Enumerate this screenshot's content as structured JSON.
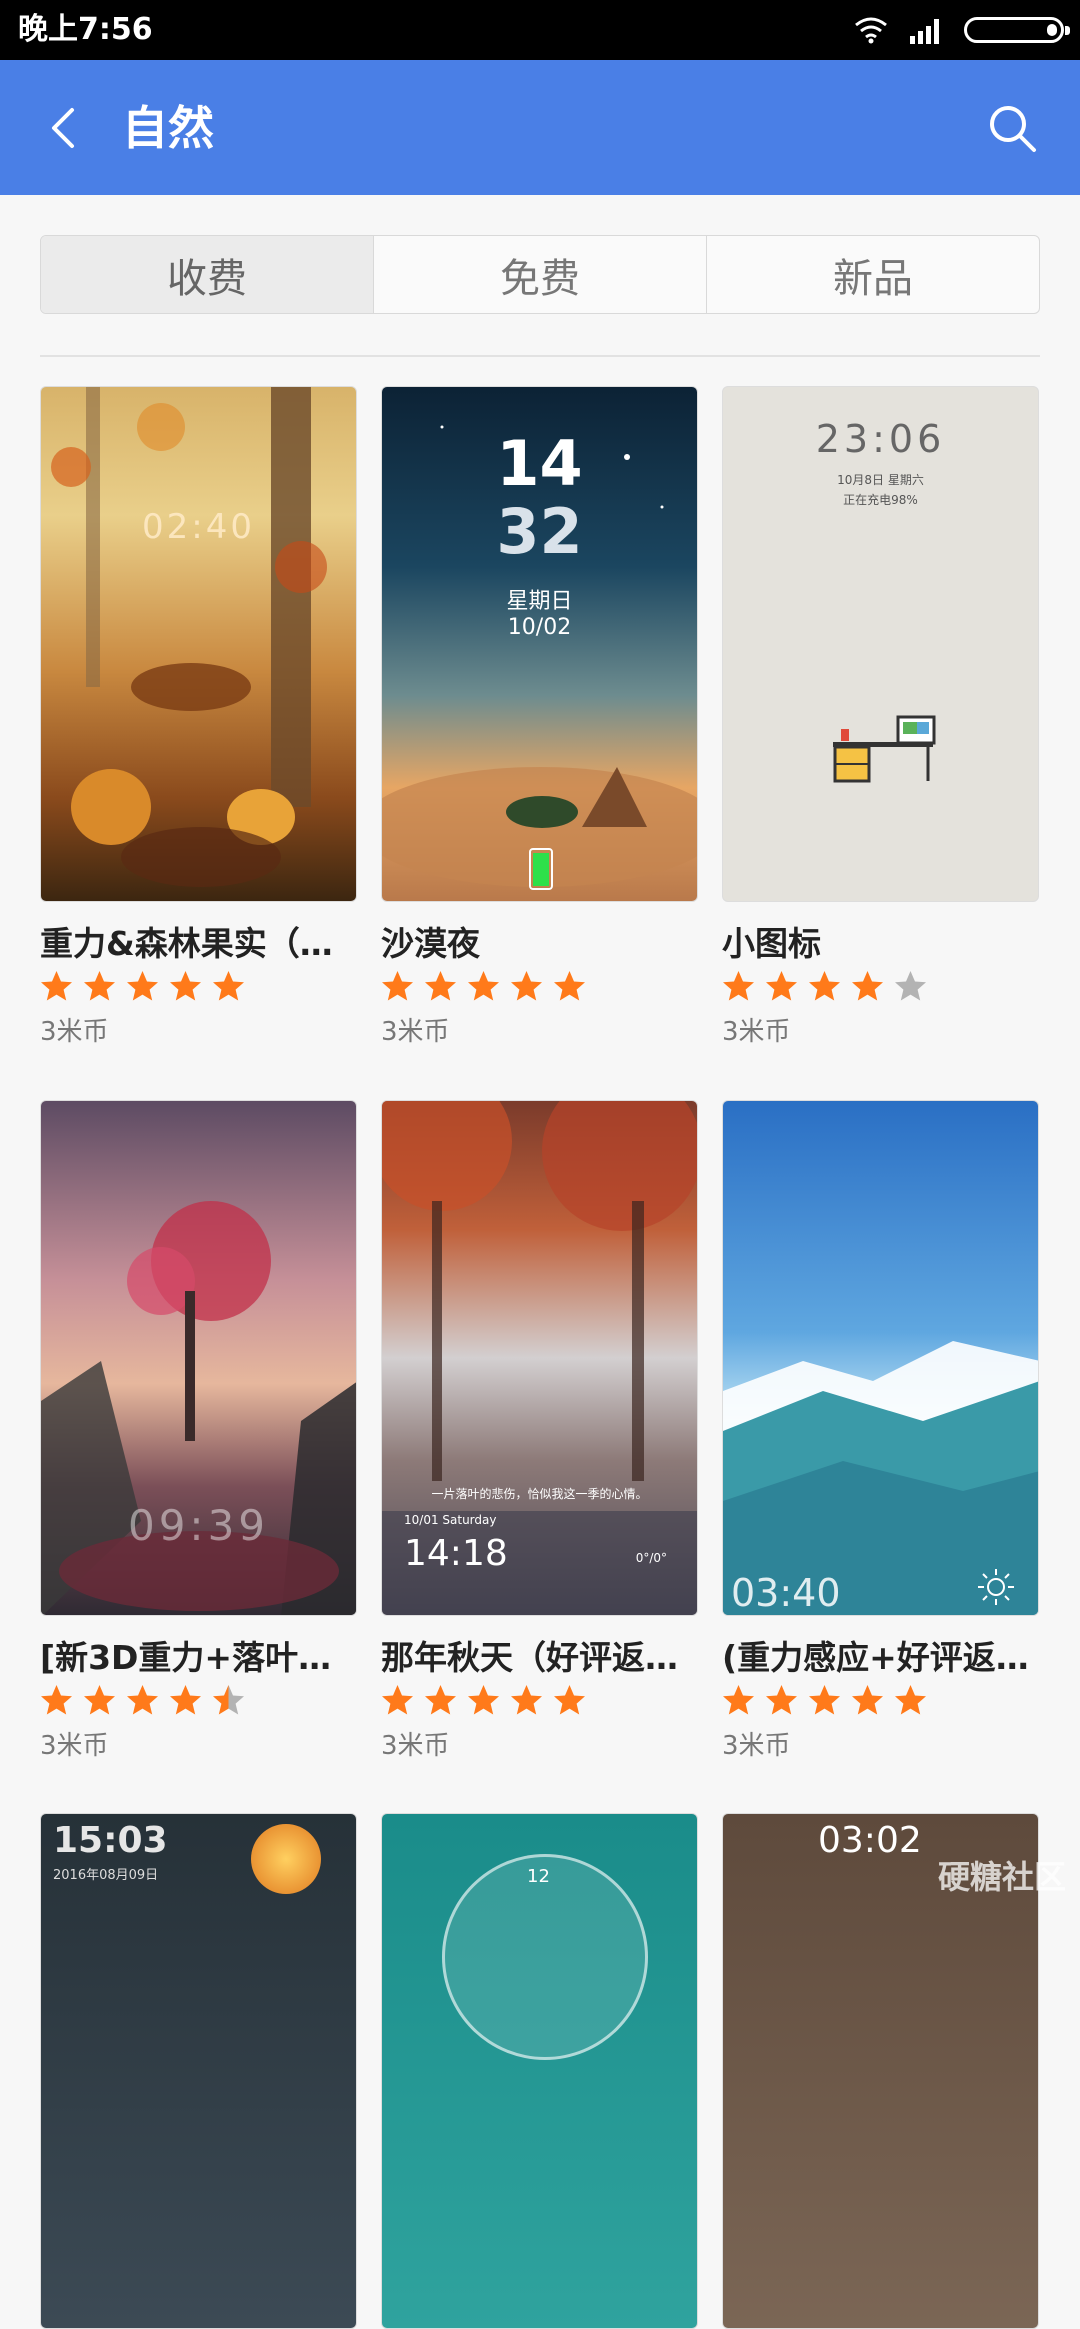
{
  "status_bar": {
    "time": "晚上7:56"
  },
  "header": {
    "title": "自然"
  },
  "tabs": [
    {
      "label": "收费",
      "active": true
    },
    {
      "label": "免费",
      "active": false
    },
    {
      "label": "新品",
      "active": false
    }
  ],
  "themes": [
    {
      "title": "重力&森林果实（最…",
      "rating": 5,
      "price": "3米币",
      "preview_clock": "02:40"
    },
    {
      "title": "沙漠夜",
      "rating": 5,
      "price": "3米币",
      "preview_hour": "14",
      "preview_minute": "32",
      "preview_weekday": "星期日",
      "preview_date": "10/02"
    },
    {
      "title": "小图标",
      "rating": 4,
      "price": "3米币",
      "preview_clock": "23:06",
      "preview_date": "10月8日  星期六",
      "preview_status": "正在充电98%"
    },
    {
      "title": "[新3D重力+落叶特…",
      "rating": 4.5,
      "price": "3米币",
      "preview_clock": "09:39"
    },
    {
      "title": "那年秋天（好评返…",
      "rating": 5,
      "price": "3米币",
      "preview_quote": "一片落叶的悲伤，恰似我这一季的心情。",
      "preview_date": "10/01 Saturday",
      "preview_clock": "14:18",
      "preview_temp": "0°/0°"
    },
    {
      "title": "(重力感应+好评返现…",
      "rating": 5,
      "price": "3米币",
      "preview_clock": "03:40"
    },
    {
      "preview_clock": "15:03",
      "preview_date": "2016年08月09日"
    },
    {
      "preview_clock": "12"
    },
    {
      "preview_clock": "03:02"
    }
  ],
  "watermark": "硬糖社区",
  "colors": {
    "header": "#4a7fe6",
    "star": "#ff7a1a",
    "star_empty": "#b3b3b3"
  }
}
